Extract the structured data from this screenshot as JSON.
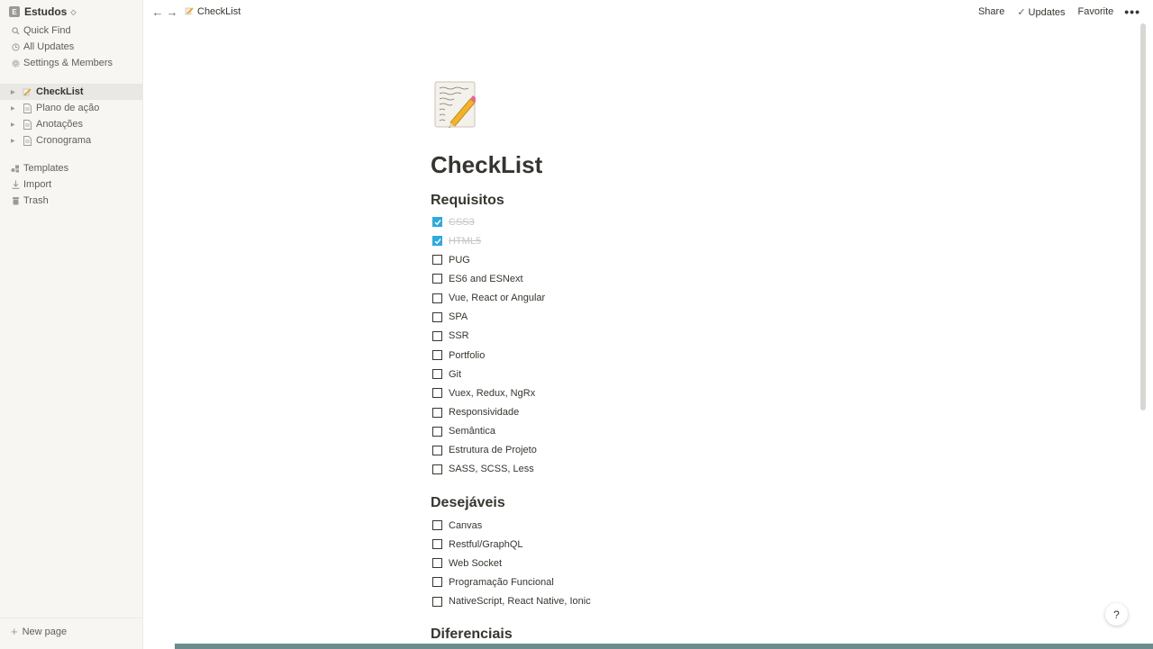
{
  "sidebar": {
    "workspace": {
      "badge": "E",
      "name": "Estudos",
      "chevron": "◇"
    },
    "quick_find": "Quick Find",
    "all_updates": "All Updates",
    "settings": "Settings & Members",
    "pages": [
      {
        "label": "CheckList",
        "icon": "memo-emoji-icon",
        "active": true
      },
      {
        "label": "Plano de ação",
        "icon": "page-icon"
      },
      {
        "label": "Anotações",
        "icon": "page-icon"
      },
      {
        "label": "Cronograma",
        "icon": "page-icon"
      }
    ],
    "templates": "Templates",
    "import": "Import",
    "trash": "Trash",
    "new_page": "New page"
  },
  "topbar": {
    "breadcrumb": "CheckList",
    "share": "Share",
    "updates": "Updates",
    "favorite": "Favorite",
    "more": "•••"
  },
  "page": {
    "title": "CheckList",
    "sections": [
      {
        "heading": "Requisitos",
        "items": [
          {
            "label": "CSS3",
            "checked": true
          },
          {
            "label": "HTML5",
            "checked": true
          },
          {
            "label": "PUG",
            "checked": false
          },
          {
            "label": "ES6 and ESNext",
            "checked": false
          },
          {
            "label": "Vue, React or Angular",
            "checked": false
          },
          {
            "label": "SPA",
            "checked": false
          },
          {
            "label": "SSR",
            "checked": false
          },
          {
            "label": "Portfolio",
            "checked": false
          },
          {
            "label": "Git",
            "checked": false
          },
          {
            "label": "Vuex, Redux, NgRx",
            "checked": false
          },
          {
            "label": "Responsividade",
            "checked": false
          },
          {
            "label": "Semântica",
            "checked": false
          },
          {
            "label": "Estrutura de Projeto",
            "checked": false
          },
          {
            "label": "SASS, SCSS, Less",
            "checked": false
          }
        ]
      },
      {
        "heading": "Desejáveis",
        "items": [
          {
            "label": "Canvas",
            "checked": false
          },
          {
            "label": "Restful/GraphQL",
            "checked": false
          },
          {
            "label": "Web Socket",
            "checked": false
          },
          {
            "label": "Programação Funcional",
            "checked": false
          },
          {
            "label": "NativeScript, React Native, Ionic",
            "checked": false
          }
        ]
      },
      {
        "heading": "Diferenciais",
        "items": []
      }
    ]
  },
  "help": "?",
  "colors": {
    "checkbox_checked": "#2eaadc",
    "sidebar_bg": "#f7f6f3",
    "text": "#37352f"
  }
}
